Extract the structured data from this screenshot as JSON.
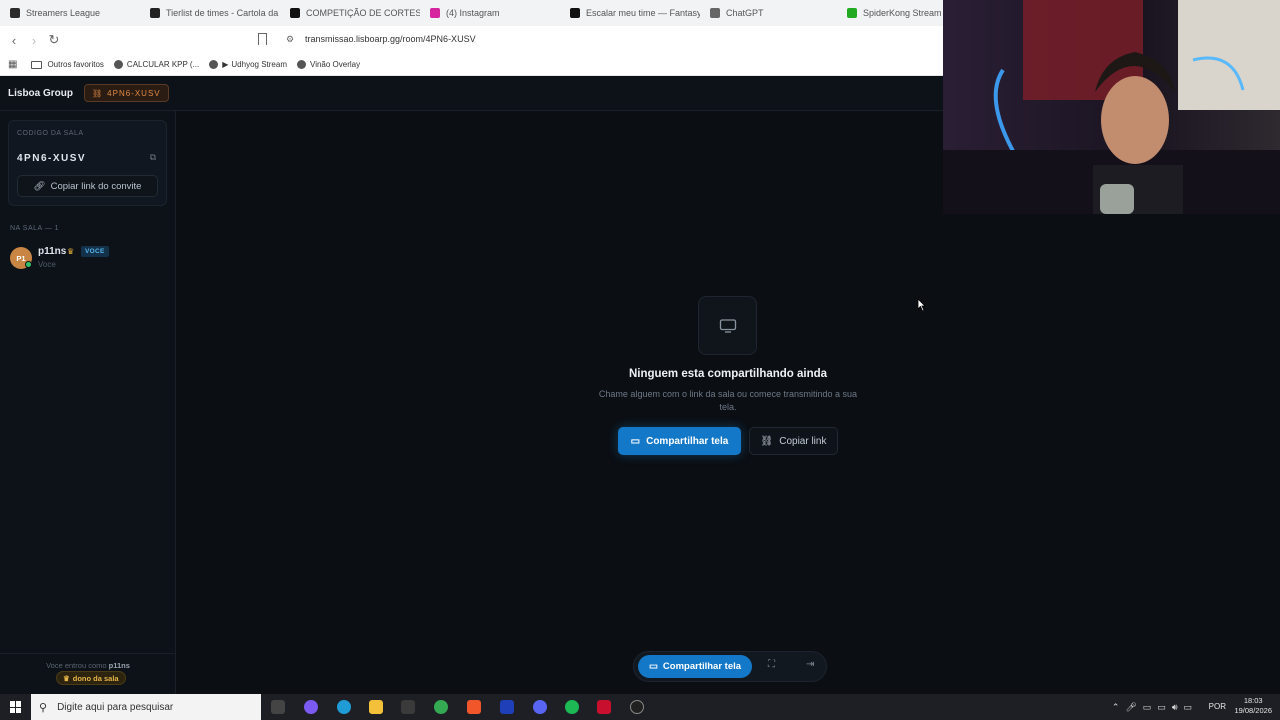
{
  "browser": {
    "tabs": [
      {
        "title": "Streamers League",
        "color": "#2b2b2b"
      },
      {
        "title": "Tierlist de times - Cartola da S",
        "color": "#222"
      },
      {
        "title": "COMPETIÇÃO DE CORTES DO",
        "color": "#111"
      },
      {
        "title": "(4) Instagram",
        "color": "#d6249f"
      },
      {
        "title": "Escalar meu time — Fantasy d",
        "color": "#111"
      },
      {
        "title": "ChatGPT",
        "color": "#666"
      },
      {
        "title": "SpiderKong Stream - V",
        "color": "#22aa22"
      }
    ],
    "url": "transmissao.lisboarp.gg/room/4PN6-XUSV",
    "bookmarks": [
      "Outros favoritos",
      "CALCULAR KPP (...",
      "Udhyog Stream",
      "Vinão Overlay"
    ]
  },
  "app": {
    "brand": "Lisboa Group",
    "room_chip": "4PN6-XUSV"
  },
  "sidebar": {
    "code_label": "CODIGO DA SALA",
    "code_value": "4PN6-XUSV",
    "invite_button": "Copiar link do convite",
    "in_room_label": "NA SALA — 1",
    "member": {
      "initials": "P1",
      "name": "p11ns",
      "badge": "VOCE",
      "subtitle": "Voce"
    },
    "footer_prefix": "Voce entrou como",
    "footer_user": "p11ns",
    "owner_badge": "dono da sala"
  },
  "main": {
    "empty_title": "Ninguem esta compartilhando ainda",
    "empty_subtitle": "Chame alguem com o link da sala ou comece transmitindo a sua tela.",
    "share_button": "Compartilhar tela",
    "copy_button": "Copiar link"
  },
  "bottom_bar": {
    "share_button": "Compartilhar tela"
  },
  "taskbar": {
    "search_placeholder": "Digite aqui para pesquisar",
    "language": "POR",
    "time": "18:03",
    "date": "19/08/2026"
  }
}
